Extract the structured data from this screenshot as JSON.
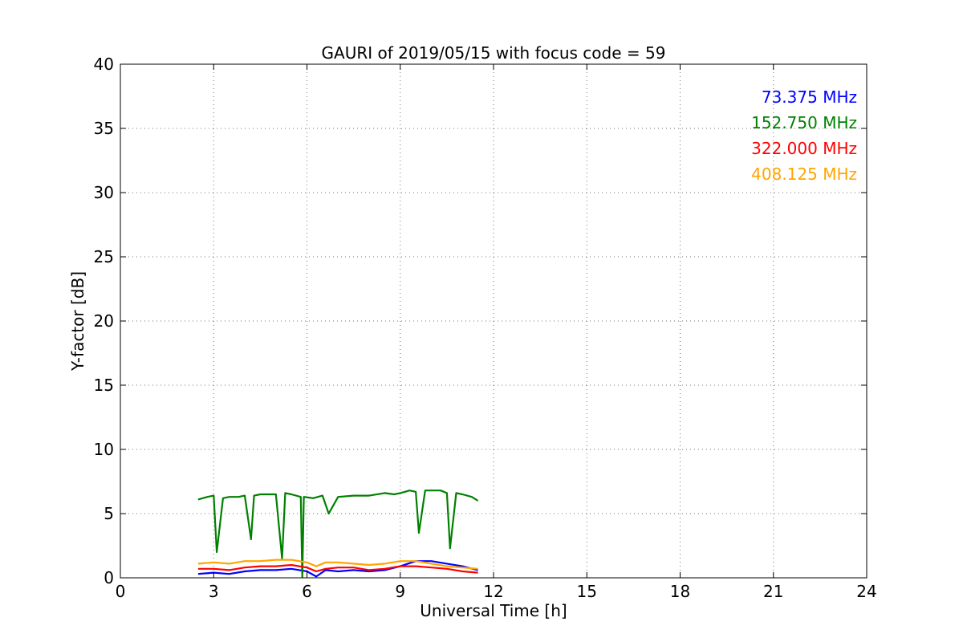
{
  "chart_data": {
    "type": "line",
    "title": "GAURI of 2019/05/15 with focus code = 59",
    "xlabel": "Universal Time [h]",
    "ylabel": "Y-factor [dB]",
    "xlim": [
      0,
      24
    ],
    "ylim": [
      0,
      40
    ],
    "xticks": [
      0,
      3,
      6,
      9,
      12,
      15,
      18,
      21,
      24
    ],
    "yticks": [
      0,
      5,
      10,
      15,
      20,
      25,
      30,
      35,
      40
    ],
    "grid": true,
    "legend_position": "top-right",
    "series": [
      {
        "name": "73.375 MHz",
        "color": "#0000ff",
        "x": [
          2.5,
          3.0,
          3.5,
          4.0,
          4.5,
          5.0,
          5.5,
          6.0,
          6.3,
          6.6,
          7.0,
          7.5,
          8.0,
          8.5,
          9.0,
          9.5,
          10.0,
          10.5,
          11.0,
          11.5
        ],
        "y": [
          0.3,
          0.4,
          0.3,
          0.5,
          0.6,
          0.6,
          0.7,
          0.5,
          0.1,
          0.6,
          0.5,
          0.6,
          0.5,
          0.6,
          0.9,
          1.3,
          1.3,
          1.1,
          0.9,
          0.6
        ]
      },
      {
        "name": "152.750 MHz",
        "color": "#008000",
        "x": [
          2.5,
          2.8,
          3.0,
          3.1,
          3.3,
          3.5,
          3.8,
          4.0,
          4.2,
          4.3,
          4.5,
          4.8,
          5.0,
          5.2,
          5.3,
          5.5,
          5.8,
          5.85,
          5.9,
          6.2,
          6.5,
          6.7,
          7.0,
          7.5,
          8.0,
          8.5,
          8.8,
          9.0,
          9.3,
          9.5,
          9.6,
          9.8,
          10.0,
          10.3,
          10.5,
          10.6,
          10.8,
          11.0,
          11.3,
          11.5
        ],
        "y": [
          6.1,
          6.3,
          6.4,
          2.0,
          6.2,
          6.3,
          6.3,
          6.4,
          3.0,
          6.4,
          6.5,
          6.5,
          6.5,
          1.5,
          6.6,
          6.5,
          6.3,
          0.0,
          6.3,
          6.2,
          6.4,
          5.0,
          6.3,
          6.4,
          6.4,
          6.6,
          6.5,
          6.6,
          6.8,
          6.7,
          3.5,
          6.8,
          6.8,
          6.8,
          6.6,
          2.3,
          6.6,
          6.5,
          6.3,
          6.0
        ]
      },
      {
        "name": "322.000 MHz",
        "color": "#ff0000",
        "x": [
          2.5,
          3.0,
          3.5,
          4.0,
          4.5,
          5.0,
          5.5,
          6.0,
          6.3,
          6.6,
          7.0,
          7.5,
          8.0,
          8.5,
          9.0,
          9.5,
          10.0,
          10.5,
          11.0,
          11.5
        ],
        "y": [
          0.7,
          0.7,
          0.6,
          0.8,
          0.9,
          0.9,
          1.0,
          0.8,
          0.5,
          0.7,
          0.8,
          0.8,
          0.6,
          0.7,
          0.9,
          0.9,
          0.8,
          0.7,
          0.5,
          0.4
        ]
      },
      {
        "name": "408.125 MHz",
        "color": "#ffa500",
        "x": [
          2.5,
          3.0,
          3.5,
          4.0,
          4.5,
          5.0,
          5.5,
          6.0,
          6.3,
          6.6,
          7.0,
          7.5,
          8.0,
          8.5,
          9.0,
          9.5,
          10.0,
          10.5,
          11.0,
          11.5
        ],
        "y": [
          1.1,
          1.2,
          1.1,
          1.3,
          1.3,
          1.4,
          1.4,
          1.2,
          0.9,
          1.2,
          1.2,
          1.1,
          1.0,
          1.1,
          1.3,
          1.3,
          1.1,
          0.9,
          0.8,
          0.7
        ]
      }
    ]
  }
}
